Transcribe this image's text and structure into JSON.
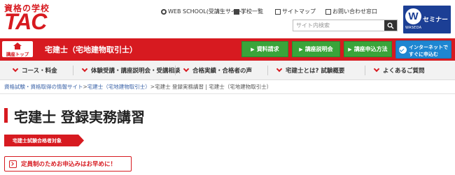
{
  "brand": {
    "subtitle": "資格の学校",
    "name": "TAC"
  },
  "utility_links": [
    {
      "label": "WEB SCHOOL(受講生サイト)",
      "icon": "gear-icon"
    },
    {
      "label": "学校一覧",
      "icon": "building-icon"
    },
    {
      "label": "サイトマップ",
      "icon": "sitemap-icon"
    },
    {
      "label": "お問い合わせ窓口",
      "icon": "mail-icon"
    }
  ],
  "search": {
    "placeholder": "サイト内検索"
  },
  "seminar_banner": {
    "label": "セミナー",
    "mark": "W",
    "org": "WASEDA"
  },
  "course_bar": {
    "top_label": "講座トップ",
    "course_name": "宅建士（宅地建物取引士）",
    "buttons": [
      "資料請求",
      "講座説明会",
      "講座申込方法"
    ],
    "apply_line1": "インターネットで",
    "apply_line2": "すぐに申込む"
  },
  "nav": [
    "コース・料金",
    "体験受講・講座説明会・受講相談",
    "合格実績・合格者の声",
    "宅建士とは? 試験概要",
    "よくあるご質問"
  ],
  "breadcrumb": {
    "links": [
      "資格試験・資格取得の情報サイト",
      "宅建士（宅地建物取引士）"
    ],
    "separator": ">",
    "current": "宅建士 登録実務講習 | 宅建士（宅地建物取引士）"
  },
  "page": {
    "title": "宅建士 登録実務講習",
    "target_ribbon": "宅建士試験合格者対象",
    "notice": "定員制のためお申込みはお早めに！"
  },
  "colors": {
    "brand_red": "#d71a20",
    "button_green": "#3aa43a",
    "button_blue": "#1e86d1",
    "seminar_navy": "#1c3f95",
    "link_blue": "#3b63a8"
  }
}
